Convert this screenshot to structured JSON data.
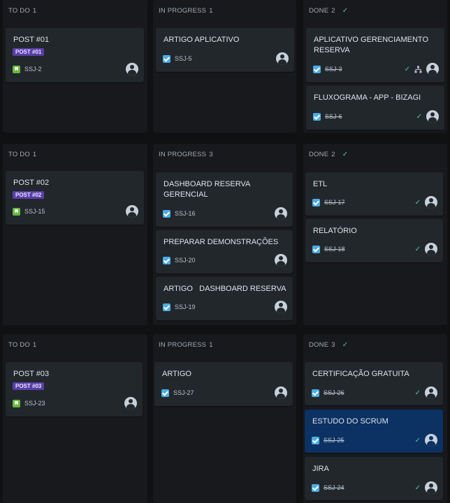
{
  "columns": {
    "todo": "TO DO",
    "inprogress": "IN PROGRESS",
    "done": "DONE"
  },
  "swimlanes": [
    {
      "todo_count": "1",
      "inprogress_count": "1",
      "done_count": "2",
      "todo_cards": [
        {
          "title": "POST #01",
          "epic": "POST #01",
          "key": "SSJ-2"
        }
      ],
      "inprogress_cards": [
        {
          "title": "ARTIGO APLICATIVO",
          "key": "SSJ-5"
        }
      ],
      "done_cards": [
        {
          "title": "APLICATIVO GERENCIAMENTO RESERVA",
          "key": "SSJ-3"
        },
        {
          "title": "FLUXOGRAMA - APP - BIZAGI",
          "key": "SSJ-6"
        }
      ]
    },
    {
      "todo_count": "1",
      "inprogress_count": "3",
      "done_count": "2",
      "todo_cards": [
        {
          "title": "POST #02",
          "epic": "POST #02",
          "key": "SSJ-15"
        }
      ],
      "inprogress_cards": [
        {
          "title": "DASHBOARD RESERVA GERENCIAL",
          "key": "SSJ-16"
        },
        {
          "title": "PREPARAR DEMONSTRAÇÕES",
          "key": "SSJ-20"
        },
        {
          "title": "ARTIGO   DASHBOARD RESERVA",
          "key": "SSJ-19"
        }
      ],
      "done_cards": [
        {
          "title": "ETL",
          "key": "SSJ-17"
        },
        {
          "title": "RELATÓRIO",
          "key": "SSJ-18"
        }
      ]
    },
    {
      "todo_count": "1",
      "inprogress_count": "1",
      "done_count": "3",
      "todo_cards": [
        {
          "title": "POST #03",
          "epic": "POST #03",
          "key": "SSJ-23"
        }
      ],
      "inprogress_cards": [
        {
          "title": "ARTIGO",
          "key": "SSJ-27"
        }
      ],
      "done_cards": [
        {
          "title": "CERTIFICAÇÃO GRATUITA",
          "key": "SSJ-26"
        },
        {
          "title": "ESTUDO DO SCRUM",
          "key": "SSJ-25"
        },
        {
          "title": "JIRA",
          "key": "SSJ-24"
        }
      ]
    }
  ],
  "icons": {
    "story": "story-icon",
    "task": "task-icon",
    "check": "check-icon",
    "avatar": "avatar-icon",
    "hierarchy": "hierarchy-icon"
  },
  "colors": {
    "background": "#0f1113",
    "column": "#17191c",
    "card": "#22272b",
    "selected_card": "#0c3163",
    "epic": "#5a3fa8",
    "story": "#63ba3c",
    "task": "#4bade8",
    "done_check": "#4bce97"
  }
}
